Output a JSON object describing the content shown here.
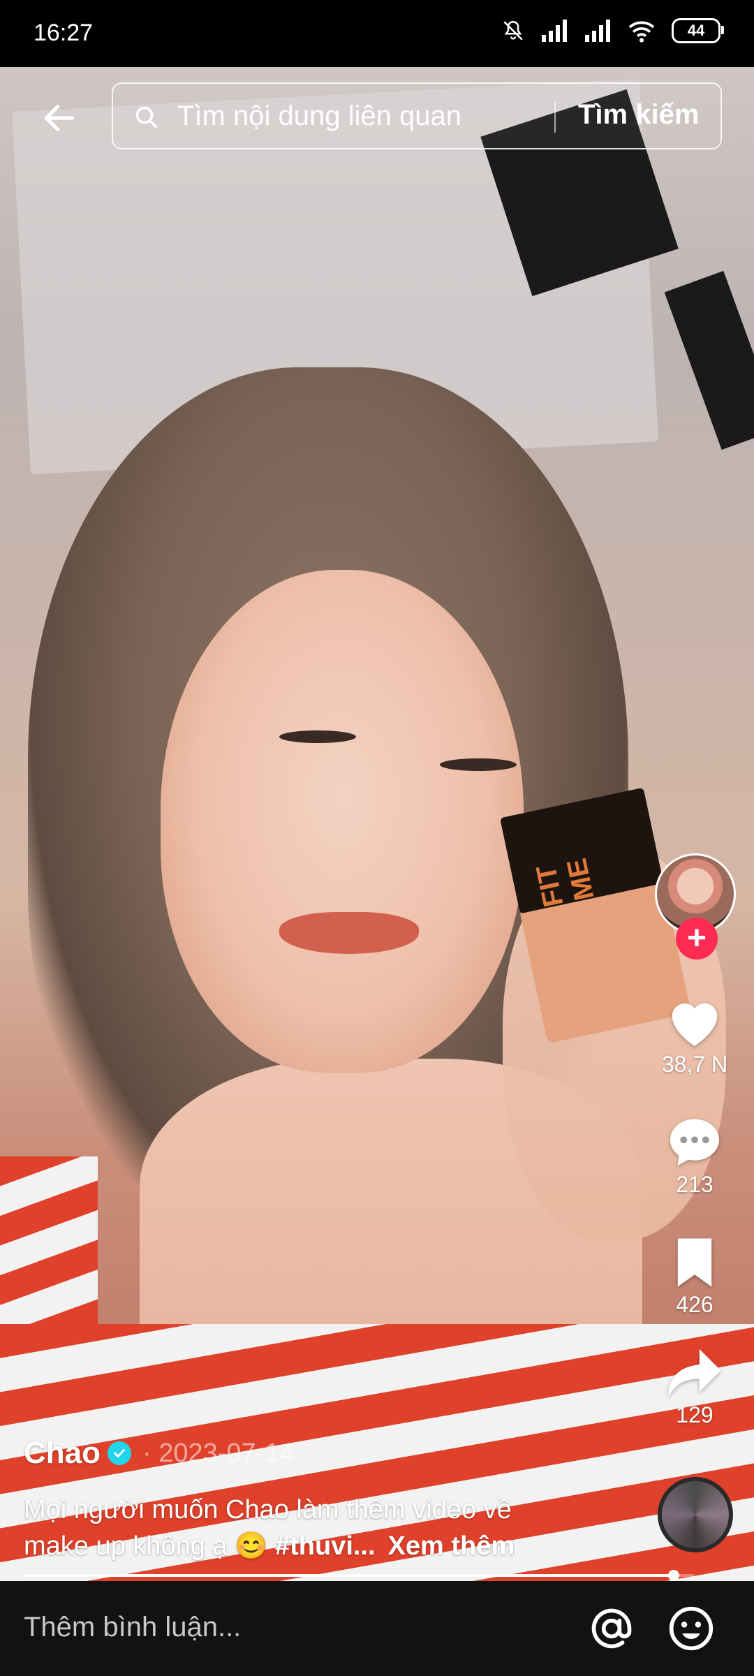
{
  "status_bar": {
    "time": "16:27",
    "battery": "44"
  },
  "search": {
    "placeholder": "Tìm nội dung liên quan",
    "submit_label": "Tìm kiếm"
  },
  "product_label": "FIT ME",
  "actions": {
    "likes": "38,7 N",
    "comments": "213",
    "saves": "426",
    "shares": "129"
  },
  "post": {
    "author": "Chao",
    "date": "· 2023-07-14",
    "caption_text": "Mọi người muốn Chao làm thêm video về make up không ạ 😊 ",
    "hashtag": "#thuvi...",
    "see_more": "Xem thêm",
    "progress_fraction": 0.97
  },
  "comment_bar": {
    "placeholder": "Thêm bình luận..."
  },
  "colors": {
    "follow_plus": "#fe2c55",
    "verified": "#20d5ec"
  }
}
